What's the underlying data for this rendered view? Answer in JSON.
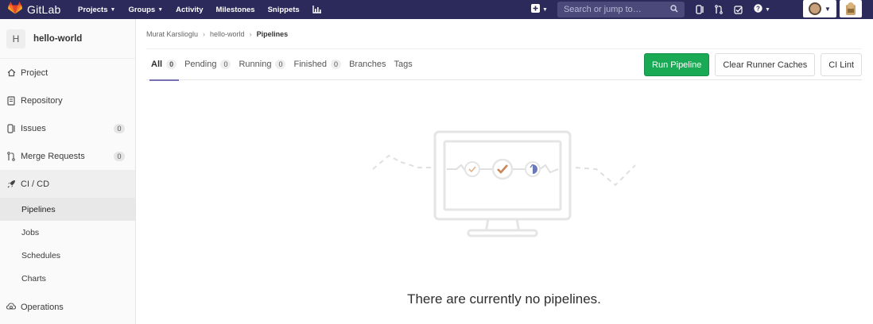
{
  "navbar": {
    "brand": "GitLab",
    "links": [
      "Projects",
      "Groups",
      "Activity",
      "Milestones",
      "Snippets"
    ],
    "search_placeholder": "Search or jump to…",
    "colors": {
      "bg": "#2b2a5a",
      "search_bg": "#4a497a"
    }
  },
  "sidebar": {
    "project_initial": "H",
    "project_name": "hello-world",
    "items": [
      {
        "label": "Project",
        "icon": "home-icon"
      },
      {
        "label": "Repository",
        "icon": "doc-icon"
      },
      {
        "label": "Issues",
        "icon": "issues-icon",
        "count": "0"
      },
      {
        "label": "Merge Requests",
        "icon": "merge-request-icon",
        "count": "0"
      },
      {
        "label": "CI / CD",
        "icon": "rocket-icon"
      }
    ],
    "sub_items": [
      "Pipelines",
      "Jobs",
      "Schedules",
      "Charts"
    ],
    "operations_label": "Operations"
  },
  "breadcrumb": [
    "Murat Karslioglu",
    "hello-world",
    "Pipelines"
  ],
  "tabs": [
    {
      "label": "All",
      "count": "0"
    },
    {
      "label": "Pending",
      "count": "0"
    },
    {
      "label": "Running",
      "count": "0"
    },
    {
      "label": "Finished",
      "count": "0"
    },
    {
      "label": "Branches"
    },
    {
      "label": "Tags"
    }
  ],
  "buttons": {
    "run": "Run Pipeline",
    "clear": "Clear Runner Caches",
    "lint": "CI Lint"
  },
  "empty_state": {
    "message": "There are currently no pipelines."
  },
  "accent": "#1aaa55"
}
